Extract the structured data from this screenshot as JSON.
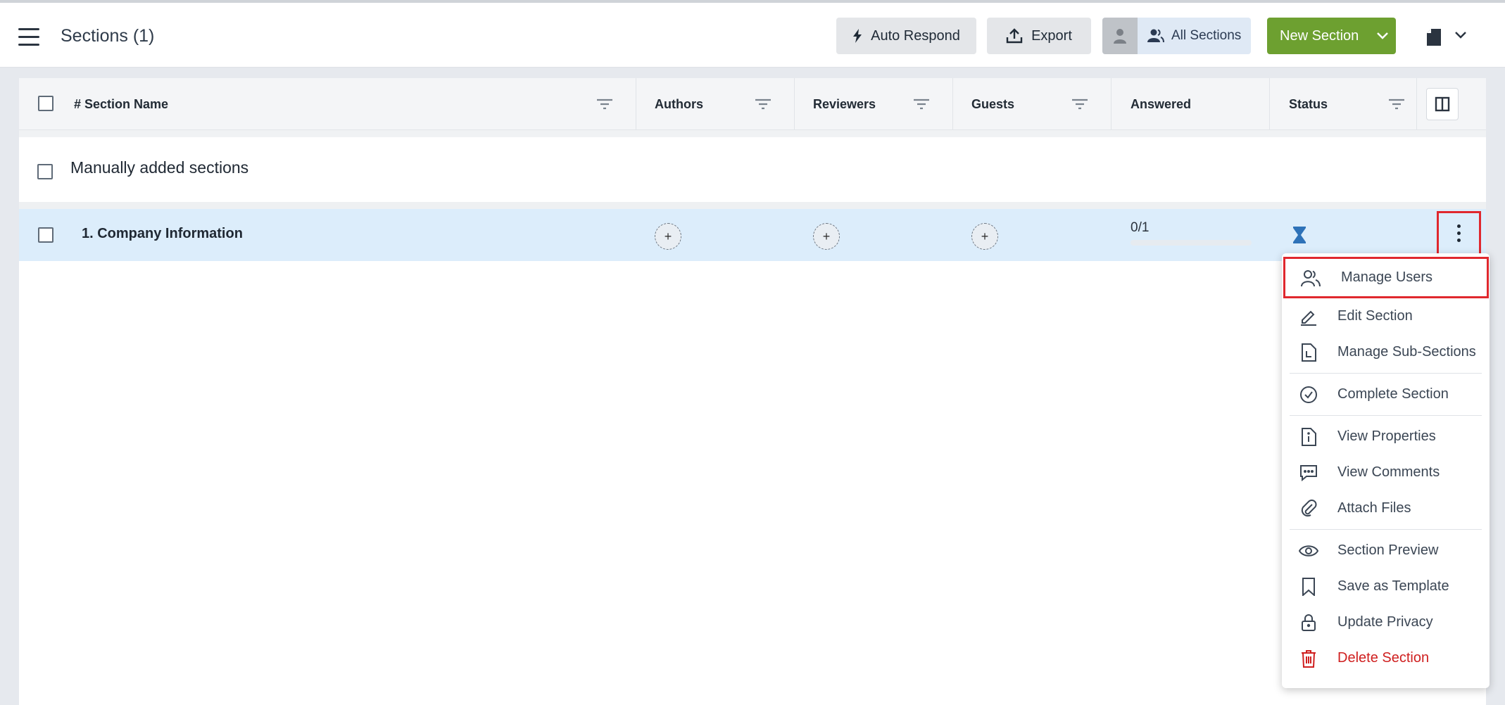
{
  "header": {
    "title": "Sections (1)",
    "auto_respond": "Auto Respond",
    "export": "Export",
    "all_sections": "All Sections",
    "new_section": "New Section"
  },
  "table": {
    "columns": [
      "# Section Name",
      "Authors",
      "Reviewers",
      "Guests",
      "Answered",
      "Status"
    ],
    "group": {
      "label": "Manually added sections"
    },
    "rows": [
      {
        "name": "1. Company Information",
        "answered": "0/1",
        "progress": 0
      }
    ]
  },
  "menu": {
    "items": [
      {
        "label": "Manage Users",
        "icon": "users-icon"
      },
      {
        "label": "Edit Section",
        "icon": "pencil-icon"
      },
      {
        "label": "Manage Sub-Sections",
        "icon": "document-icon"
      },
      {
        "label": "Complete Section",
        "icon": "check-circle-icon"
      },
      {
        "label": "View Properties",
        "icon": "info-icon"
      },
      {
        "label": "View Comments",
        "icon": "comment-icon"
      },
      {
        "label": "Attach Files",
        "icon": "paperclip-icon"
      },
      {
        "label": "Section Preview",
        "icon": "eye-icon"
      },
      {
        "label": "Save as Template",
        "icon": "bookmark-icon"
      },
      {
        "label": "Update Privacy",
        "icon": "lock-icon"
      },
      {
        "label": "Delete Section",
        "icon": "trash-icon"
      }
    ]
  },
  "colors": {
    "accent_green": "#6da030",
    "highlight_red": "#e0282e",
    "row_selected": "#dcedfb",
    "danger": "#cf1f1f",
    "status_blue": "#2e72b8"
  }
}
